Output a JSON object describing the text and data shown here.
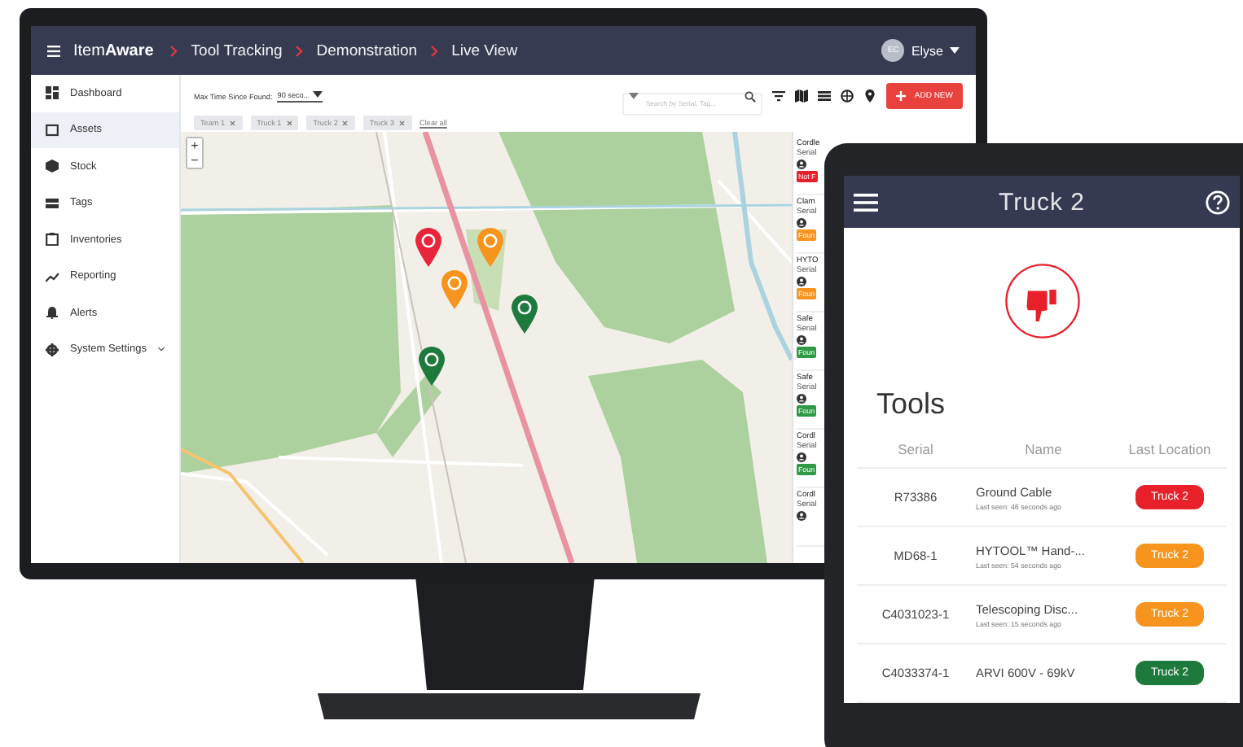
{
  "app_bar": {
    "brand": "Item**Aware**",
    "breadcrumbs": [
      "Tool Tracking",
      "Demonstration",
      "Live View"
    ],
    "user": {
      "initials": "EC",
      "name": "Elyse"
    }
  },
  "sidebar": {
    "items": [
      {
        "label": "Dashboard",
        "selected": false,
        "kind": "link"
      },
      {
        "label": "Assets",
        "selected": true,
        "kind": "link"
      },
      {
        "label": "Stock",
        "selected": false,
        "kind": "link"
      },
      {
        "label": "Tags",
        "selected": false,
        "kind": "link"
      },
      {
        "label": "Inventories",
        "selected": false,
        "kind": "link"
      },
      {
        "label": "Reporting",
        "selected": false,
        "kind": "link"
      },
      {
        "label": "Alerts",
        "selected": false,
        "kind": "link"
      },
      {
        "label": "System Settings",
        "selected": false,
        "kind": "group"
      }
    ]
  },
  "filters": {
    "max_time_label": "Max Time Since Found:",
    "max_time_value": "90 seco...",
    "chips": [
      "Team 1",
      "Truck 1",
      "Truck 2",
      "Truck 3"
    ],
    "clear_all": "Clear all",
    "search": {
      "placeholder": "Search by Serial, Tag..."
    },
    "add_button": "ADD NEW"
  },
  "map": {
    "zoom_in": "+",
    "zoom_out": "−",
    "pins": [
      {
        "color": "#e8253b"
      },
      {
        "color": "#f7941d"
      },
      {
        "color": "#f7941d"
      },
      {
        "color": "#1e7a3c"
      },
      {
        "color": "#1e7a3c"
      }
    ]
  },
  "asset_list": {
    "items": [
      {
        "title": "Cordle",
        "serial": "Serial",
        "badge": "Not F",
        "color": "#e8202a"
      },
      {
        "title": "Clam",
        "serial": "Serial",
        "badge": "Foun",
        "color": "#f7941d"
      },
      {
        "title": "HYTO",
        "serial": "Serial",
        "badge": "Foun",
        "color": "#f7941d"
      },
      {
        "title": "Safe",
        "serial": "Serial",
        "badge": "Foun",
        "color": "#2e9a46"
      },
      {
        "title": "Safe",
        "serial": "Serial",
        "badge": "Foun",
        "color": "#2e9a46"
      },
      {
        "title": "Cordl",
        "serial": "Serial",
        "badge": "Foun",
        "color": "#2e9a46"
      },
      {
        "title": "Cordl",
        "serial": "Serial"
      }
    ]
  },
  "tablet": {
    "title": "Truck 2",
    "heading": "Tools",
    "columns": [
      "Serial",
      "Name",
      "Last Location"
    ],
    "rows": [
      {
        "serial": "R73386",
        "name": "Ground Cable",
        "last_seen": "Last seen: 46 seconds ago",
        "location": "Truck 2",
        "color": "#e8202a"
      },
      {
        "serial": "MD68-1",
        "name": "HYTOOL™ Hand-...",
        "last_seen": "Last seen: 54 seconds ago",
        "location": "Truck 2",
        "color": "#f7941d"
      },
      {
        "serial": "C4031023-1",
        "name": "Telescoping Disc...",
        "last_seen": "Last seen: 15 seconds ago",
        "location": "Truck 2",
        "color": "#f7941d"
      },
      {
        "serial": "C4033374-1",
        "name": "ARVI 600V - 69kV",
        "location": "Truck 2",
        "color": "#1e7a3c"
      }
    ]
  }
}
